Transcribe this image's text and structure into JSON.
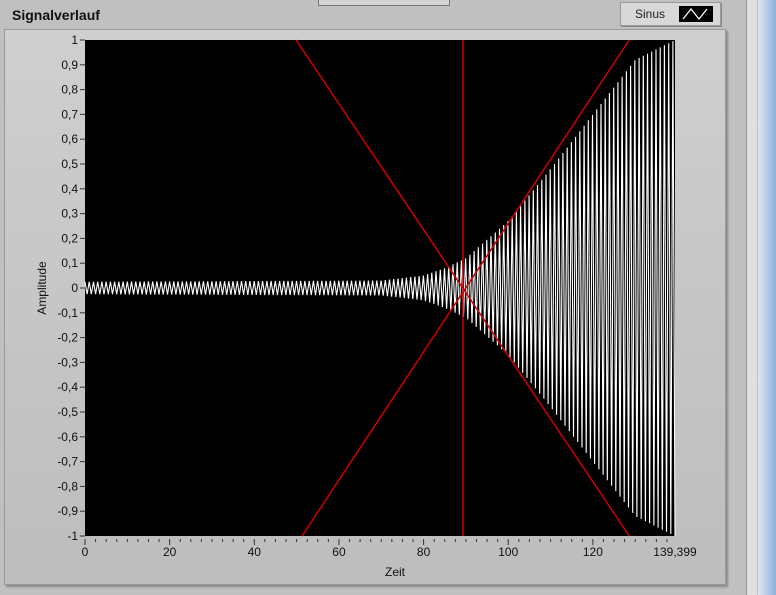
{
  "header": {
    "title": "Signalverlauf"
  },
  "legend": {
    "label": "Sinus"
  },
  "chart_data": {
    "type": "line",
    "title": "Signalverlauf",
    "xlabel": "Zeit",
    "ylabel": "Amplitude",
    "xlim": [
      0,
      139.399
    ],
    "ylim": [
      -1,
      1
    ],
    "xticks": [
      "0",
      "20",
      "40",
      "60",
      "80",
      "100",
      "120",
      "139,399"
    ],
    "xtick_values": [
      0,
      20,
      40,
      60,
      80,
      100,
      120,
      139.399
    ],
    "yticks": [
      "1",
      "0,9",
      "0,8",
      "0,7",
      "0,6",
      "0,5",
      "0,4",
      "0,3",
      "0,2",
      "0,1",
      "0",
      "-0,1",
      "-0,2",
      "-0,3",
      "-0,4",
      "-0,5",
      "-0,6",
      "-0,7",
      "-0,8",
      "-0,9",
      "-1"
    ],
    "series": [
      {
        "name": "Sinus",
        "color": "#ffffff",
        "envelope_t": [
          0,
          70,
          80,
          85,
          90,
          100,
          110,
          120,
          130,
          139.4
        ],
        "envelope_a": [
          0.025,
          0.03,
          0.05,
          0.08,
          0.12,
          0.27,
          0.48,
          0.7,
          0.92,
          1.0
        ],
        "cycles_per_unit": 1.0
      }
    ],
    "cursors": [
      {
        "type": "vertical",
        "x": 89.3,
        "color": "#d00000"
      },
      {
        "type": "line",
        "from": [
          49.9,
          1
        ],
        "to": [
          128.6,
          -1
        ],
        "color": "#d00000"
      },
      {
        "type": "line",
        "from": [
          51.3,
          -1
        ],
        "to": [
          128.6,
          1
        ],
        "color": "#d00000"
      }
    ],
    "background": "#000000"
  }
}
